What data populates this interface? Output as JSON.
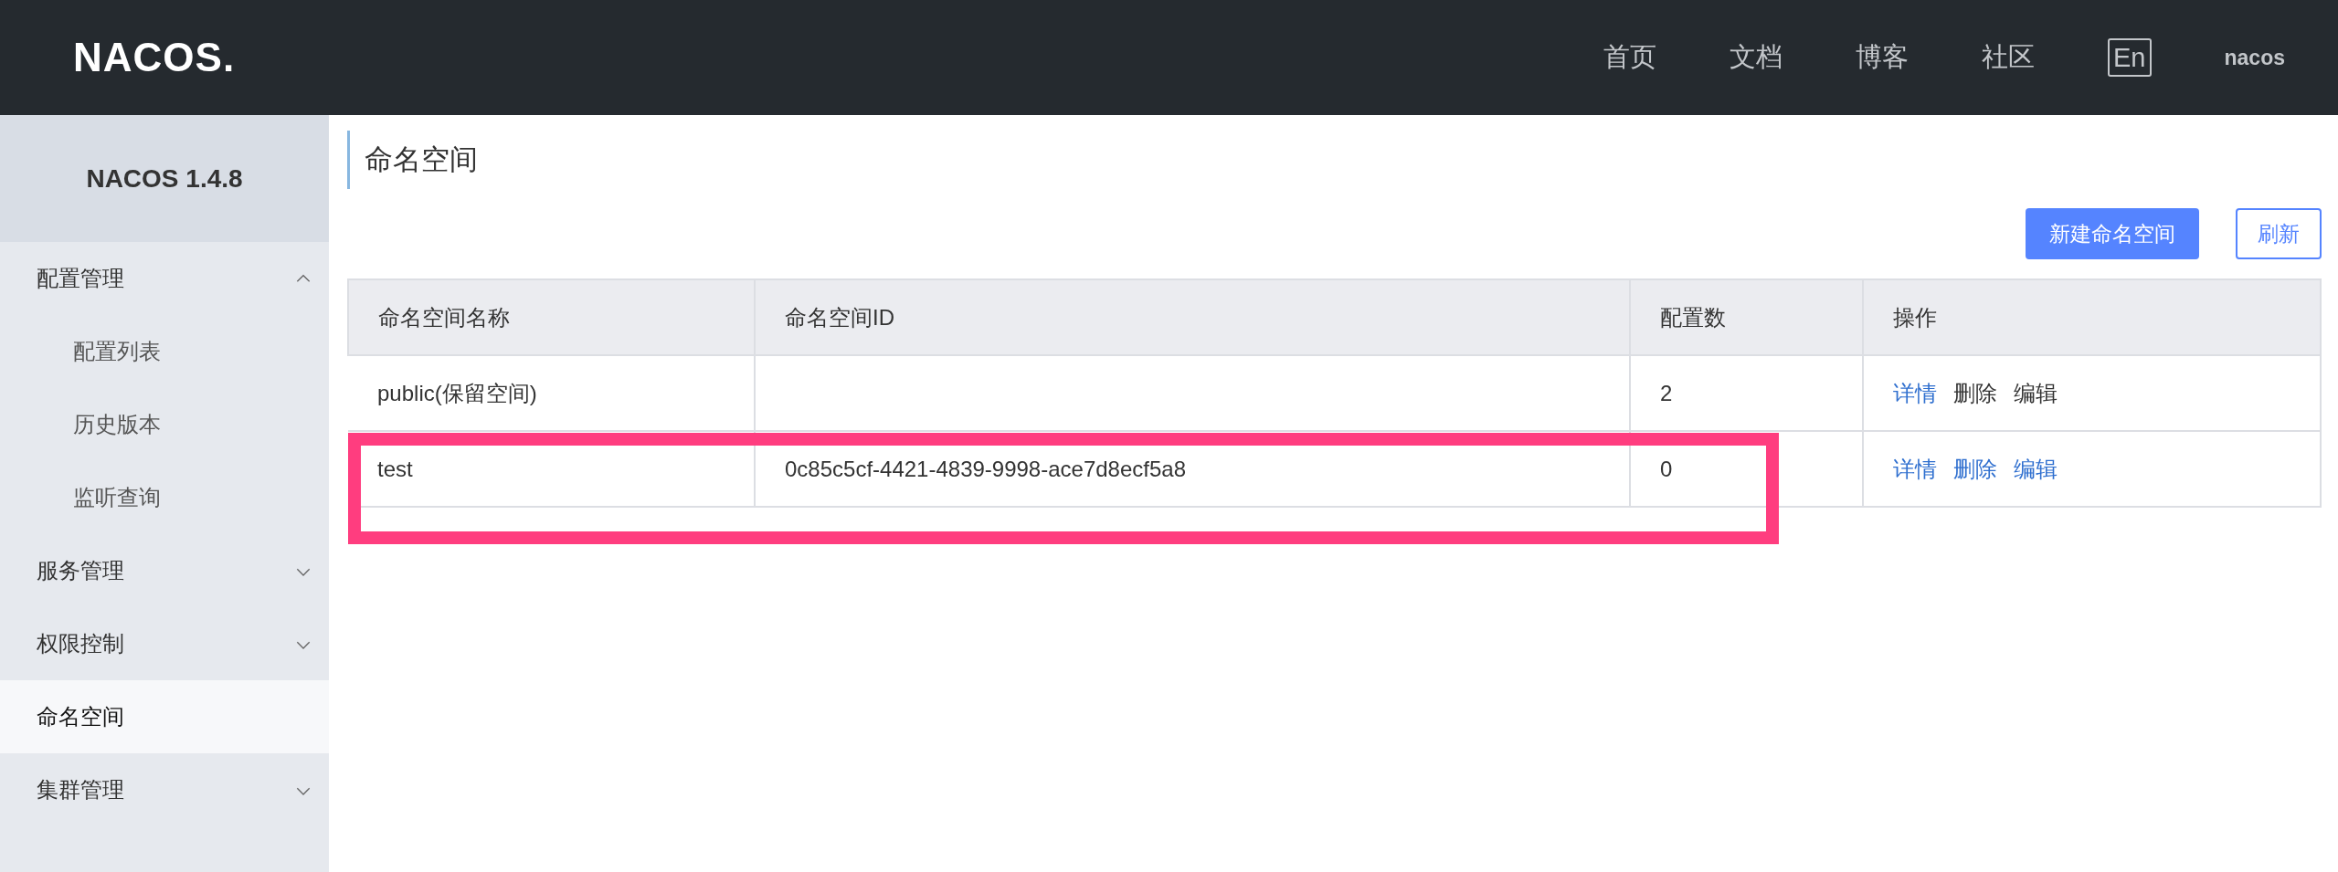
{
  "header": {
    "logo": "NACOS.",
    "nav": [
      {
        "label": "首页"
      },
      {
        "label": "文档"
      },
      {
        "label": "博客"
      },
      {
        "label": "社区"
      }
    ],
    "language": "En",
    "user": "nacos"
  },
  "sidebar": {
    "version": "NACOS 1.4.8",
    "items": [
      {
        "label": "配置管理",
        "expanded": true,
        "selected": false,
        "children": [
          {
            "label": "配置列表",
            "selected": false
          },
          {
            "label": "历史版本",
            "selected": false
          },
          {
            "label": "监听查询",
            "selected": false
          }
        ]
      },
      {
        "label": "服务管理",
        "expanded": false,
        "selected": false
      },
      {
        "label": "权限控制",
        "expanded": false,
        "selected": false
      },
      {
        "label": "命名空间",
        "selected": true
      },
      {
        "label": "集群管理",
        "expanded": false,
        "selected": false
      }
    ]
  },
  "page": {
    "title": "命名空间",
    "buttons": [
      {
        "label": "新建命名空间",
        "kind": "primary"
      },
      {
        "label": "刷新",
        "kind": "secondary"
      }
    ]
  },
  "table": {
    "columns": [
      "命名空间名称",
      "命名空间ID",
      "配置数",
      "操作"
    ],
    "rows": [
      {
        "name": "public(保留空间)",
        "config_count": "2",
        "actions": [
          {
            "label": "详情",
            "disabled": false
          },
          {
            "label": "删除",
            "disabled": true
          },
          {
            "label": "编辑",
            "disabled": true
          }
        ]
      },
      {
        "name": "test",
        "namespace_id": "0c85c5cf-4421-4839-9998-ace7d8ecf5a8",
        "config_count": "0",
        "actions": [
          {
            "label": "详情",
            "disabled": false
          },
          {
            "label": "删除",
            "disabled": false
          },
          {
            "label": "编辑",
            "disabled": false
          }
        ]
      }
    ]
  }
}
